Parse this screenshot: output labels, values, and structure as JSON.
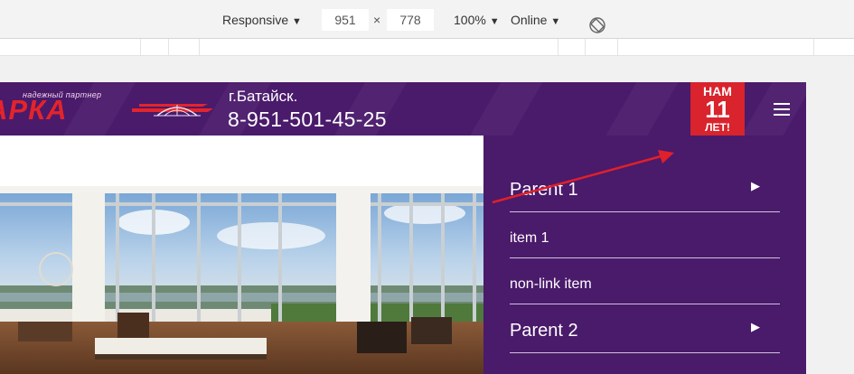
{
  "toolbar": {
    "device_label": "Responsive",
    "width_value": "951",
    "times_sign": "×",
    "height_value": "778",
    "zoom_label": "100%",
    "network_label": "Online"
  },
  "header": {
    "logo_tagline": "надежный партнер",
    "logo_text": "АРКА",
    "city": "г.Батайск.",
    "phone": "8-951-501-45-25",
    "badge": {
      "line1": "НАМ",
      "line2": "11",
      "line3": "ЛЕТ!"
    }
  },
  "menu": {
    "items": [
      {
        "label": "Parent 1",
        "has_children": true
      },
      {
        "label": "item 1",
        "has_children": false
      },
      {
        "label": "non-link item",
        "has_children": false
      },
      {
        "label": "Parent 2",
        "has_children": true
      }
    ]
  },
  "colors": {
    "header_bg": "#4a1a6b",
    "badge_bg": "#d9232d",
    "logo_red": "#e4242b",
    "annotation_arrow": "#e0202a"
  }
}
